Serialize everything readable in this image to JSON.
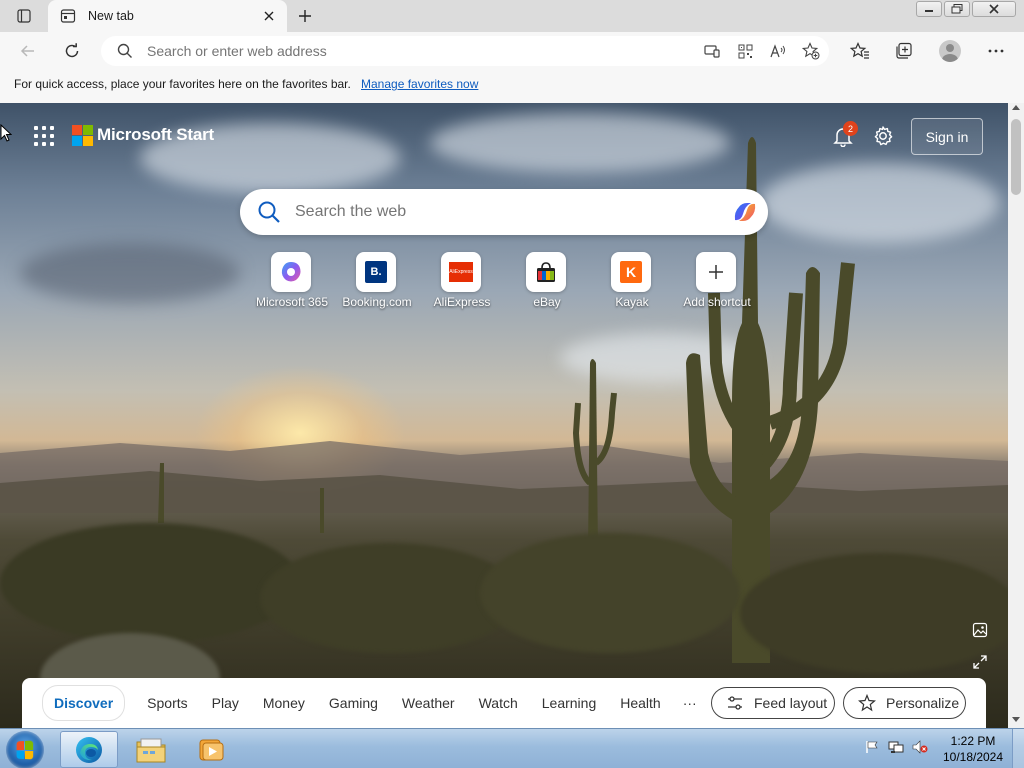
{
  "browser": {
    "tab": {
      "title": "New tab",
      "favicon": "new-tab-icon"
    },
    "window_controls": [
      "minimize",
      "restore",
      "close"
    ],
    "address_bar": {
      "placeholder": "Search or enter web address",
      "value": ""
    },
    "favorites_bar": {
      "text": "For quick access, place your favorites here on the favorites bar.",
      "link": "Manage favorites now"
    }
  },
  "start_page": {
    "brand": "Microsoft Start",
    "notification_count": "2",
    "sign_in_label": "Sign in",
    "search": {
      "placeholder": "Search the web"
    },
    "shortcuts": [
      {
        "label": "Microsoft 365",
        "icon": "microsoft-365-logo"
      },
      {
        "label": "Booking.com",
        "icon": "booking-logo",
        "glyph": "B."
      },
      {
        "label": "AliExpress",
        "icon": "aliexpress-logo",
        "glyph": "AliExpress"
      },
      {
        "label": "eBay",
        "icon": "ebay-logo"
      },
      {
        "label": "Kayak",
        "icon": "kayak-logo",
        "glyph": "K"
      },
      {
        "label": "Add shortcut",
        "icon": "plus-icon"
      }
    ],
    "feed_tabs": [
      "Discover",
      "Sports",
      "Play",
      "Money",
      "Gaming",
      "Weather",
      "Watch",
      "Learning",
      "Health",
      "···"
    ],
    "active_feed_tab": "Discover",
    "feed_layout_label": "Feed layout",
    "personalize_label": "Personalize"
  },
  "taskbar": {
    "pinned": [
      "internet-explorer-edge",
      "windows-explorer",
      "media-player"
    ],
    "active": "edge",
    "clock": {
      "time": "1:22 PM",
      "date": "10/18/2024"
    },
    "tray_icons": [
      "flag-icon",
      "network-icon",
      "volume-muted-icon"
    ]
  },
  "colors": {
    "accent": "#0f6cbd",
    "link": "#0f5cbf",
    "badge": "#e0431c",
    "chrome_bg": "#f7f7f7"
  }
}
